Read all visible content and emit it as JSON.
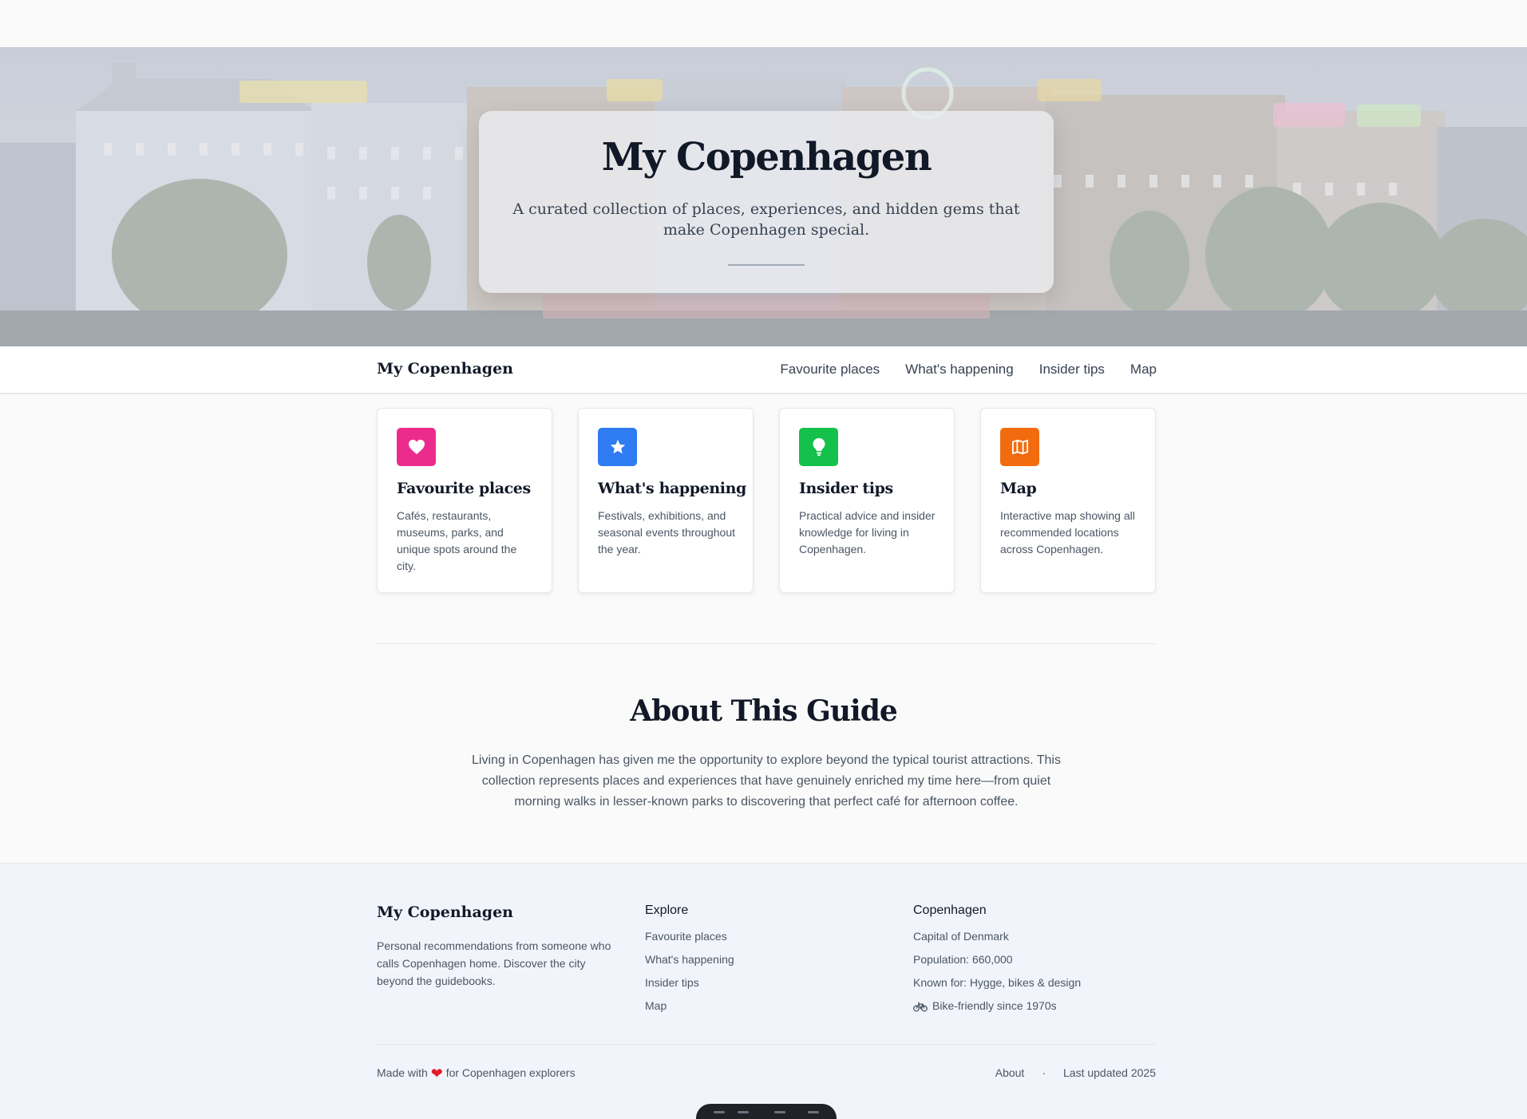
{
  "hero": {
    "title": "My Copenhagen",
    "subtitle": "A curated collection of places, experiences, and hidden gems that make Copenhagen special."
  },
  "nav": {
    "brand": "My Copenhagen",
    "links": [
      "Favourite places",
      "What's happening",
      "Insider tips",
      "Map"
    ]
  },
  "cards": [
    {
      "title": "Favourite places",
      "description": "Cafés, restaurants, museums, parks, and unique spots around the city.",
      "icon": "heart-icon",
      "color": "#ec2c8c"
    },
    {
      "title": "What's happening",
      "description": "Festivals, exhibitions, and seasonal events throughout the year.",
      "icon": "star-icon",
      "color": "#2f7bf2"
    },
    {
      "title": "Insider tips",
      "description": "Practical advice and insider knowledge for living in Copenhagen.",
      "icon": "lightbulb-icon",
      "color": "#14c14b"
    },
    {
      "title": "Map",
      "description": "Interactive map showing all recommended locations across Copenhagen.",
      "icon": "map-icon",
      "color": "#f26b0f"
    }
  ],
  "about": {
    "title": "About This Guide",
    "text": "Living in Copenhagen has given me the opportunity to explore beyond the typical tourist attractions. This collection represents places and experiences that have genuinely enriched my time here—from quiet morning walks in lesser-known parks to discovering that perfect café for afternoon coffee."
  },
  "footer": {
    "brand": "My Copenhagen",
    "description": "Personal recommendations from someone who calls Copenhagen home. Discover the city beyond the guidebooks.",
    "explore_heading": "Explore",
    "explore_links": [
      "Favourite places",
      "What's happening",
      "Insider tips",
      "Map"
    ],
    "city_heading": "Copenhagen",
    "city_facts": [
      "Capital of Denmark",
      "Population: 660,000",
      "Known for: Hygge, bikes & design",
      "Bike-friendly since 1970s"
    ],
    "made_with_prefix": "Made with",
    "made_with_suffix": "for Copenhagen explorers",
    "about_link": "About",
    "separator": "·",
    "last_updated": "Last updated 2025"
  },
  "colors": {
    "text_primary": "#111827",
    "text_secondary": "#4b5563",
    "page_bg": "#fafafa",
    "footer_bg": "#f1f5fb",
    "heart": "#e11d2a"
  }
}
